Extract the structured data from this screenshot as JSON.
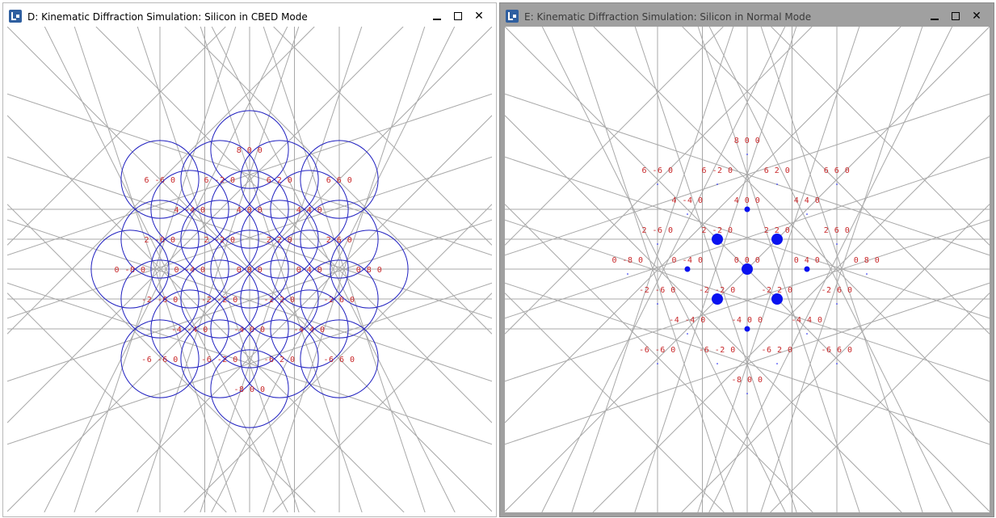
{
  "colors": {
    "line": "#a8a8a8",
    "circle": "#2020c0",
    "label": "#c8282a",
    "spot": "#0a12f0",
    "inactive_titlebar": "#a0a0a0"
  },
  "window_d": {
    "title": "D: Kinematic Diffraction Simulation:  Silicon in CBED Mode",
    "icon": "java-app-icon",
    "minimize": "minimize-icon",
    "maximize": "maximize-icon",
    "close": "close-icon",
    "close_glyph": "✕"
  },
  "window_e": {
    "title": "E: Kinematic Diffraction Simulation:  Silicon in Normal Mode",
    "icon": "java-app-icon",
    "minimize": "minimize-icon",
    "maximize": "maximize-icon",
    "close": "close-icon",
    "close_glyph": "✕"
  },
  "reflections": [
    {
      "label": "8 0 0",
      "h": 8,
      "k": 0,
      "intensity": "weak"
    },
    {
      "label": "6 -6 0",
      "h": 6,
      "k": -6,
      "intensity": "weak"
    },
    {
      "label": "6 -2 0",
      "h": 6,
      "k": -2,
      "intensity": "weak"
    },
    {
      "label": "6 2 0",
      "h": 6,
      "k": 2,
      "intensity": "weak"
    },
    {
      "label": "6 6 0",
      "h": 6,
      "k": 6,
      "intensity": "weak"
    },
    {
      "label": "4 -4 0",
      "h": 4,
      "k": -4,
      "intensity": "weak"
    },
    {
      "label": "4 0 0",
      "h": 4,
      "k": 0,
      "intensity": "medium"
    },
    {
      "label": "4 4 0",
      "h": 4,
      "k": 4,
      "intensity": "weak"
    },
    {
      "label": "2 -6 0",
      "h": 2,
      "k": -6,
      "intensity": "weak"
    },
    {
      "label": "2 -2 0",
      "h": 2,
      "k": -2,
      "intensity": "strong"
    },
    {
      "label": "2 2 0",
      "h": 2,
      "k": 2,
      "intensity": "strong"
    },
    {
      "label": "2 6 0",
      "h": 2,
      "k": 6,
      "intensity": "weak"
    },
    {
      "label": "0 -8 0",
      "h": 0,
      "k": -8,
      "intensity": "weak"
    },
    {
      "label": "0 -4 0",
      "h": 0,
      "k": -4,
      "intensity": "medium"
    },
    {
      "label": "0 0 0",
      "h": 0,
      "k": 0,
      "intensity": "strong"
    },
    {
      "label": "0 4 0",
      "h": 0,
      "k": 4,
      "intensity": "medium"
    },
    {
      "label": "0 8 0",
      "h": 0,
      "k": 8,
      "intensity": "weak"
    },
    {
      "label": "-2 -6 0",
      "h": -2,
      "k": -6,
      "intensity": "weak"
    },
    {
      "label": "-2 -2 0",
      "h": -2,
      "k": -2,
      "intensity": "strong"
    },
    {
      "label": "-2 2 0",
      "h": -2,
      "k": 2,
      "intensity": "strong"
    },
    {
      "label": "-2 6 0",
      "h": -2,
      "k": 6,
      "intensity": "weak"
    },
    {
      "label": "-4 -4 0",
      "h": -4,
      "k": -4,
      "intensity": "weak"
    },
    {
      "label": "-4 0 0",
      "h": -4,
      "k": 0,
      "intensity": "medium"
    },
    {
      "label": "-4 4 0",
      "h": -4,
      "k": 4,
      "intensity": "weak"
    },
    {
      "label": "-6 -6 0",
      "h": -6,
      "k": -6,
      "intensity": "weak"
    },
    {
      "label": "-6 -2 0",
      "h": -6,
      "k": -2,
      "intensity": "weak"
    },
    {
      "label": "-6 2 0",
      "h": -6,
      "k": 2,
      "intensity": "weak"
    },
    {
      "label": "-6 6 0",
      "h": -6,
      "k": 6,
      "intensity": "weak"
    },
    {
      "label": "-8 0 0",
      "h": -8,
      "k": 0,
      "intensity": "weak"
    }
  ]
}
